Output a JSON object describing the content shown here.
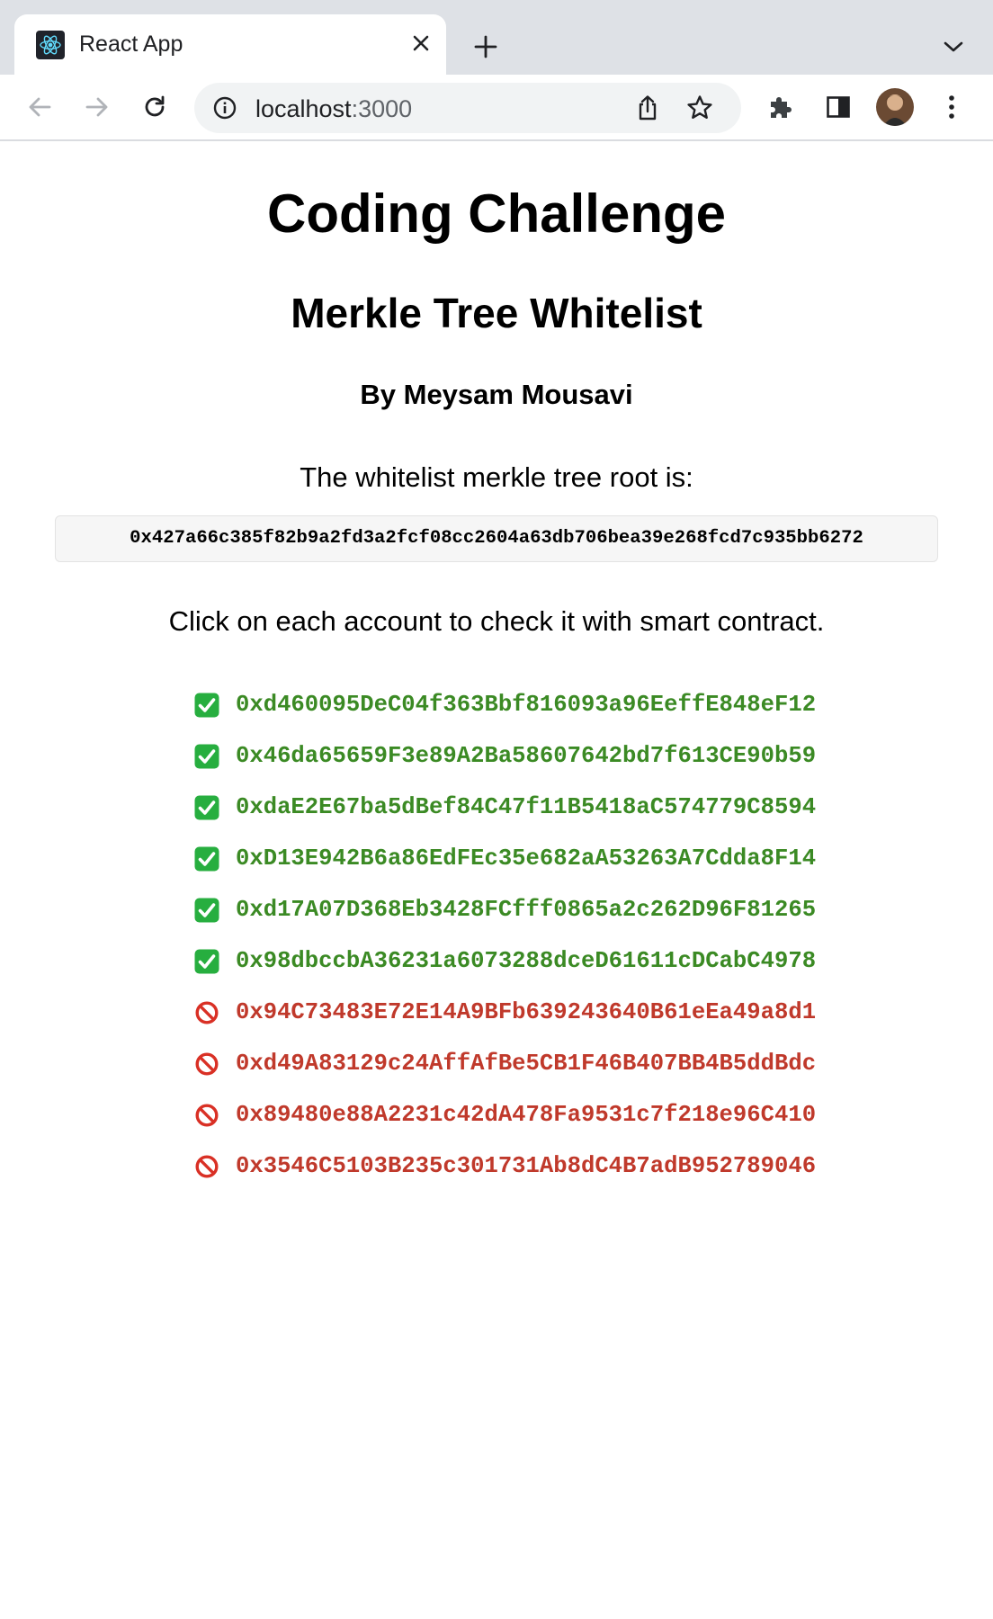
{
  "browser": {
    "tab": {
      "title": "React App",
      "favicon": "react-logo-icon"
    },
    "url": {
      "host": "localhost",
      "port": ":3000"
    },
    "icons": [
      "back-arrow-icon",
      "forward-arrow-icon",
      "reload-icon",
      "site-info-icon",
      "share-icon",
      "bookmark-star-icon",
      "extensions-icon",
      "side-panel-icon",
      "profile-avatar",
      "menu-dots-icon"
    ]
  },
  "page": {
    "title": "Coding Challenge",
    "subtitle": "Merkle Tree Whitelist",
    "author": "By Meysam Mousavi",
    "root_label": "The whitelist merkle tree root is:",
    "root_hash": "0x427a66c385f82b9a2fd3a2fcf08cc2604a63db706bea39e268fcd7c935bb6272",
    "instruction": "Click on each account to check it with smart contract."
  },
  "accounts": [
    {
      "address": "0xd460095DeC04f363Bbf816093a96EeffE848eF12",
      "status": "whitelisted",
      "icon": "check-mark-icon"
    },
    {
      "address": "0x46da65659F3e89A2Ba58607642bd7f613CE90b59",
      "status": "whitelisted",
      "icon": "check-mark-icon"
    },
    {
      "address": "0xdaE2E67ba5dBef84C47f11B5418aC574779C8594",
      "status": "whitelisted",
      "icon": "check-mark-icon"
    },
    {
      "address": "0xD13E942B6a86EdFEc35e682aA53263A7Cdda8F14",
      "status": "whitelisted",
      "icon": "check-mark-icon"
    },
    {
      "address": "0xd17A07D368Eb3428FCfff0865a2c262D96F81265",
      "status": "whitelisted",
      "icon": "check-mark-icon"
    },
    {
      "address": "0x98dbccbA36231a6073288dceD61611cDCabC4978",
      "status": "whitelisted",
      "icon": "check-mark-icon"
    },
    {
      "address": "0x94C73483E72E14A9BFb639243640B61eEa49a8d1",
      "status": "not-whitelisted",
      "icon": "prohibited-icon"
    },
    {
      "address": "0xd49A83129c24AffAfBe5CB1F46B407BB4B5ddBdc",
      "status": "not-whitelisted",
      "icon": "prohibited-icon"
    },
    {
      "address": "0x89480e88A2231c42dA478Fa9531c7f218e96C410",
      "status": "not-whitelisted",
      "icon": "prohibited-icon"
    },
    {
      "address": "0x3546C5103B235c301731Ab8dC4B7adB952789046",
      "status": "not-whitelisted",
      "icon": "prohibited-icon"
    }
  ],
  "colors": {
    "whitelisted": "#3b8a24",
    "not_whitelisted": "#c0392b",
    "check_bg": "#27ae3f",
    "prohibited": "#d93025"
  }
}
